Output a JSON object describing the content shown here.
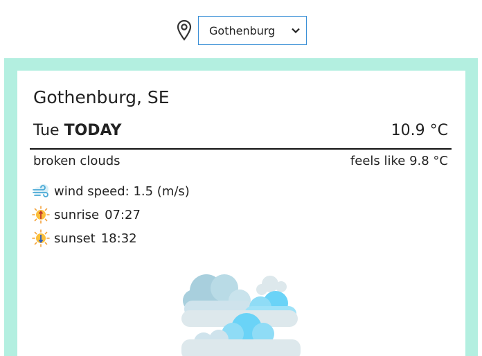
{
  "location_selector": {
    "selected": "Gothenburg",
    "options": [
      "Gothenburg"
    ]
  },
  "weather": {
    "location": "Gothenburg, SE",
    "day": "Tue",
    "today_label": "TODAY",
    "temperature": "10.9 °C",
    "description": "broken clouds",
    "feels_like": "feels like 9.8 °C",
    "wind": "wind speed: 1.5 (m/s)",
    "sunrise_label": "sunrise",
    "sunrise_time": "07:27",
    "sunset_label": "sunset",
    "sunset_time": "18:32"
  },
  "icons": {
    "location": "map-pin-icon",
    "wind": "wind-icon",
    "sunrise": "sunrise-icon",
    "sunset": "sunset-icon",
    "weather": "broken-clouds-icon"
  },
  "colors": {
    "frame": "#b3efe0",
    "select_border": "#3a8fd6",
    "cloud_light": "#cfe3ec",
    "cloud_blue": "#6ad3f7"
  }
}
